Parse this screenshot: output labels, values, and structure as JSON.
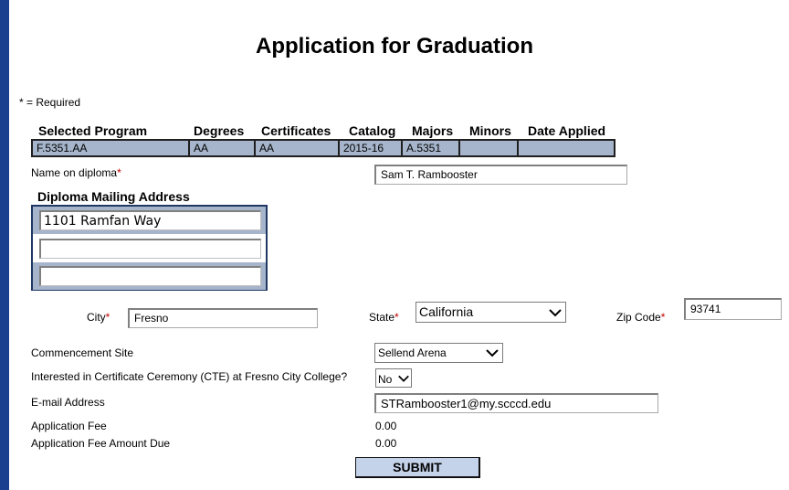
{
  "page": {
    "title": "Application for Graduation",
    "required_note": "* = Required"
  },
  "program": {
    "headers": [
      "Selected Program",
      "Degrees",
      "Certificates",
      "Catalog",
      "Majors",
      "Minors",
      "Date Applied"
    ],
    "row": [
      "F.5351.AA",
      "AA",
      "AA",
      "2015-16",
      "A.5351",
      "",
      ""
    ]
  },
  "diploma": {
    "name_label": "Name on diploma",
    "name_value": "Sam T. Rambooster",
    "address_heading": "Diploma Mailing Address",
    "address_lines": [
      "1101 Ramfan Way",
      "",
      ""
    ]
  },
  "location": {
    "city_label": "City",
    "city_value": "Fresno",
    "state_label": "State",
    "state_value": "California",
    "zip_label": "Zip Code",
    "zip_value": "93741"
  },
  "commencement": {
    "label": "Commencement Site",
    "value": "Sellend Arena"
  },
  "cte": {
    "label": "Interested in Certificate Ceremony (CTE) at Fresno City College?",
    "value": "No"
  },
  "email": {
    "label": "E-mail Address",
    "value": "STRambooster1@my.scccd.edu"
  },
  "fees": {
    "fee_label": "Application Fee",
    "fee_value": "0.00",
    "due_label": "Application Fee Amount Due",
    "due_value": "0.00"
  },
  "actions": {
    "submit_label": "SUBMIT"
  },
  "required_marker": "*",
  "colors": {
    "accent_bar": "#1a3f8f",
    "table_bg": "#a6b5cb",
    "required": "#c00000",
    "submit_bg": "#c5d3ea"
  }
}
